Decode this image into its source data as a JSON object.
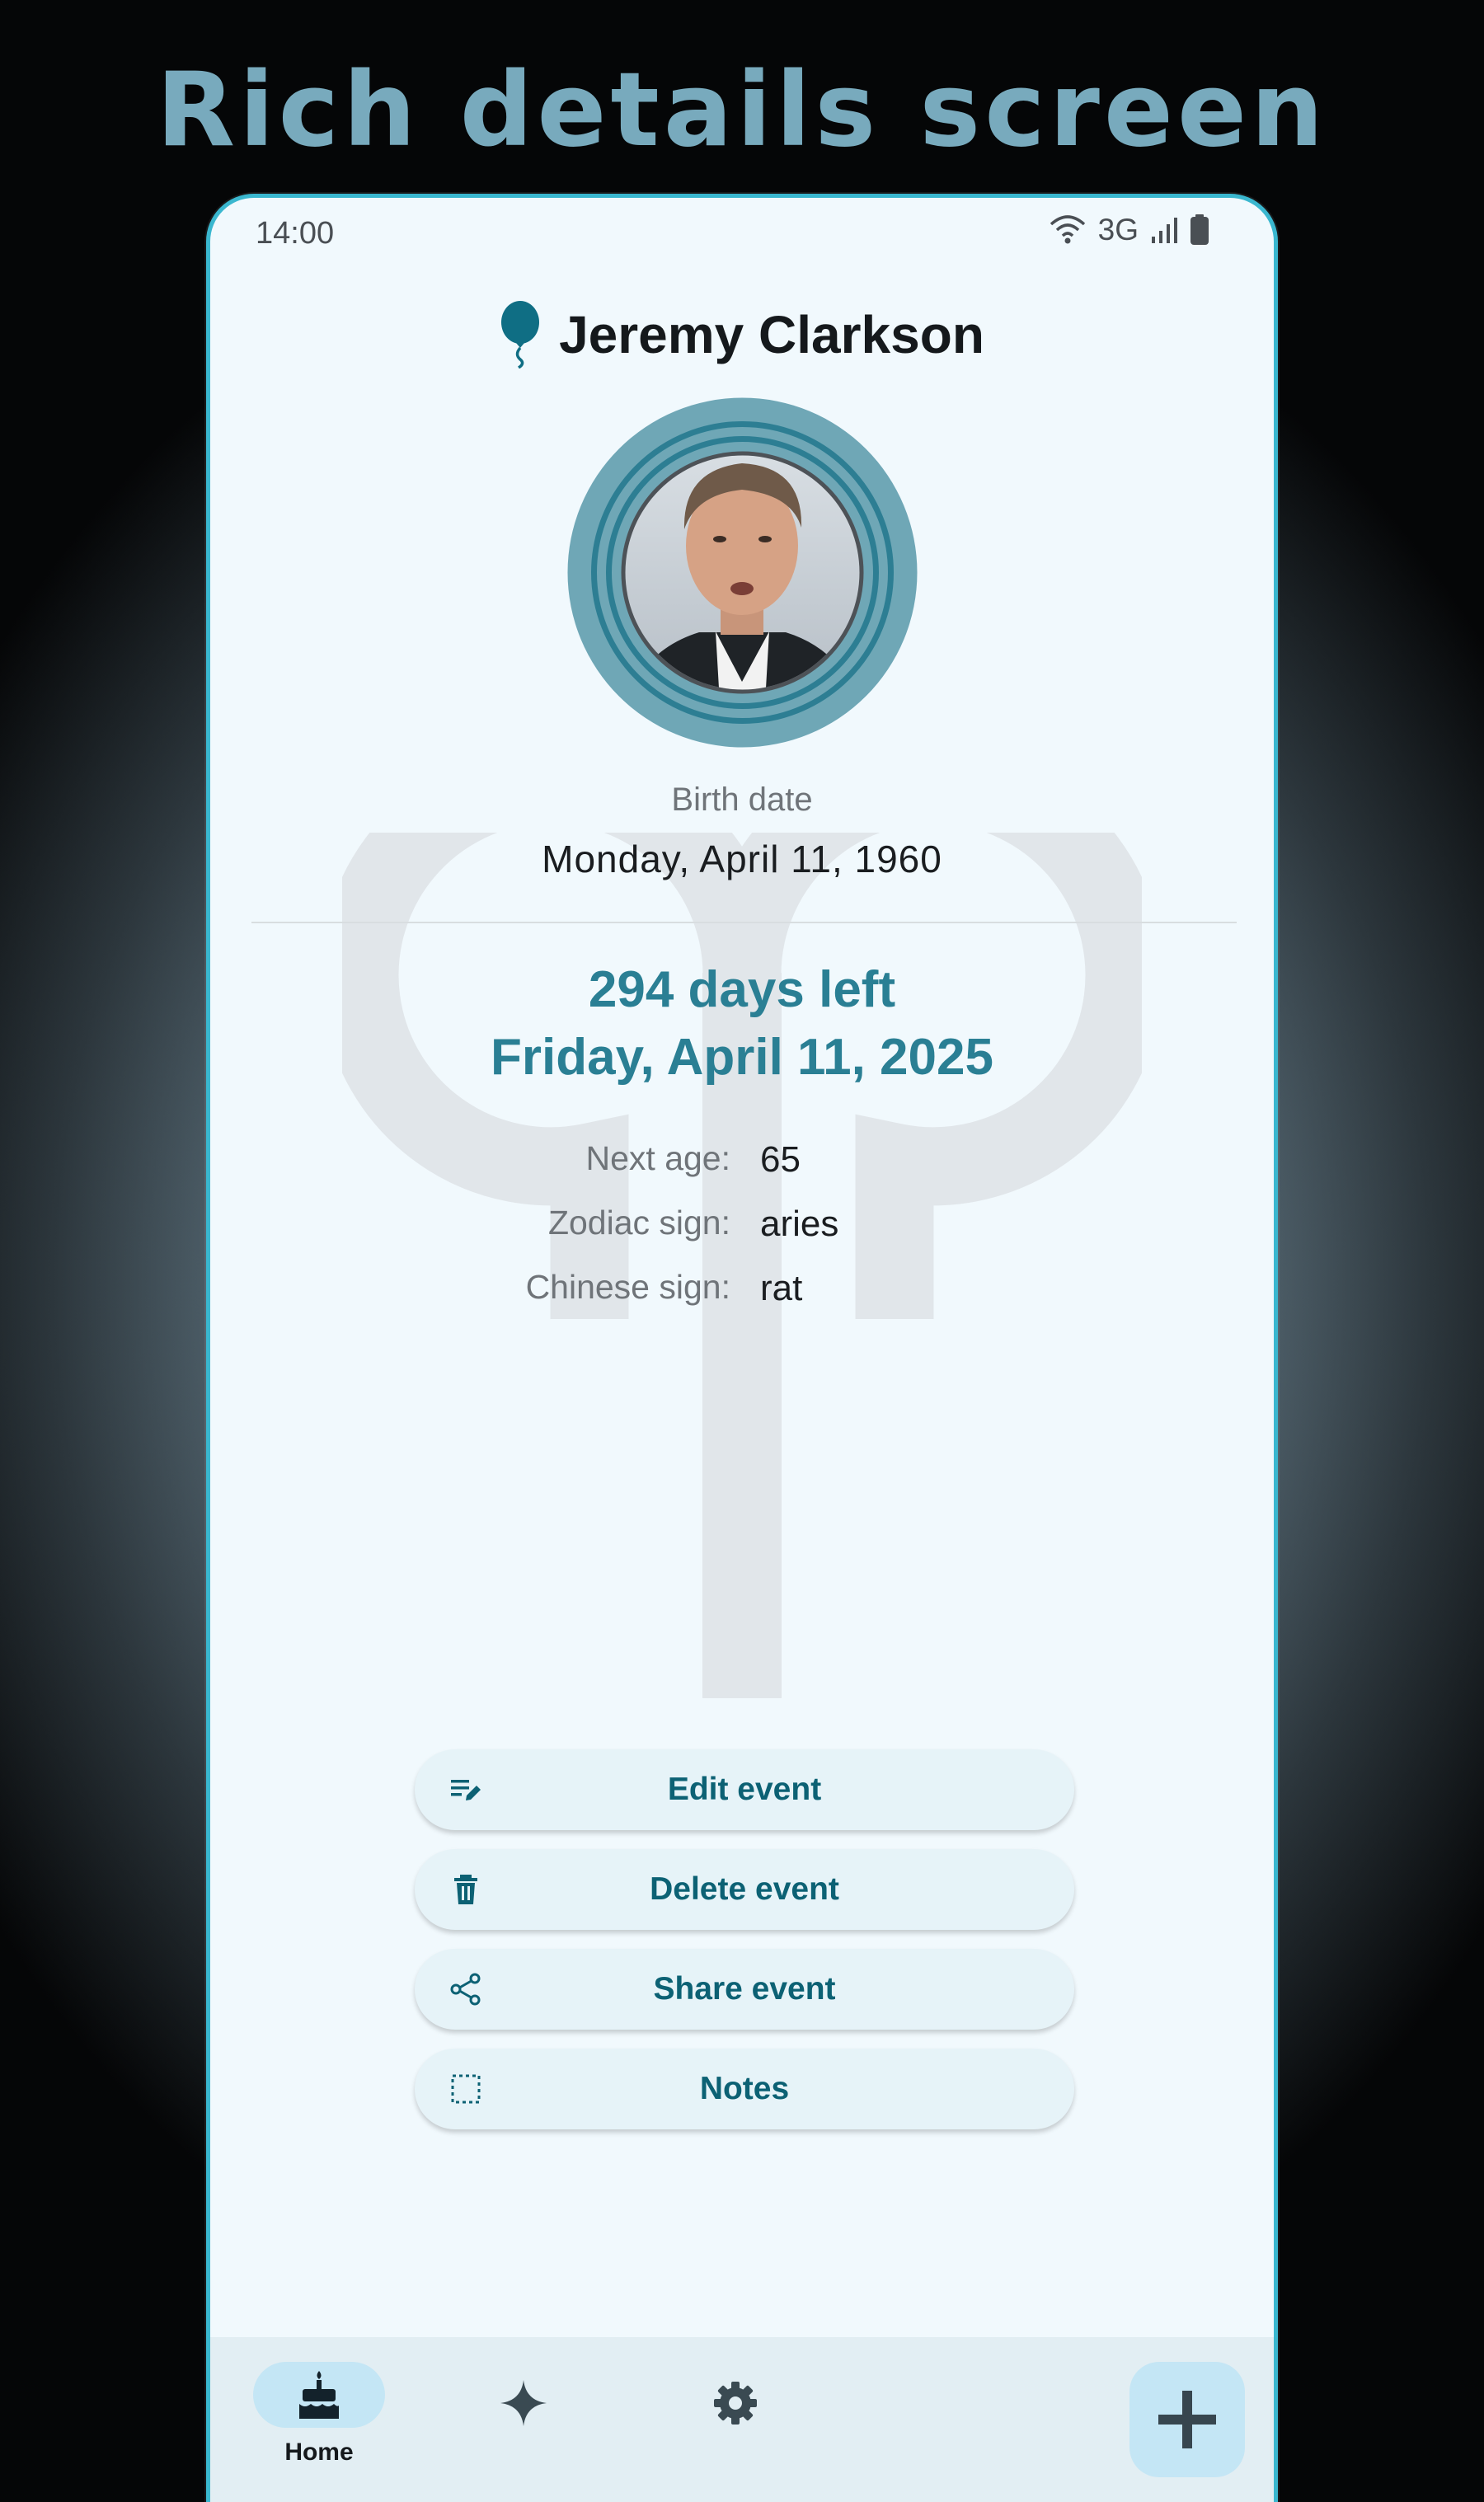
{
  "headline": "Rich details screen",
  "status_bar": {
    "time": "14:00",
    "network": "3G"
  },
  "person": {
    "name": "Jeremy Clarkson"
  },
  "birth": {
    "caption": "Birth date",
    "date": "Monday, April 11, 1960"
  },
  "countdown": {
    "days_left": "294 days left",
    "next_date": "Friday, April 11, 2025"
  },
  "info": [
    {
      "label": "Next age:",
      "value": "65"
    },
    {
      "label": "Zodiac sign:",
      "value": "aries"
    },
    {
      "label": "Chinese sign:",
      "value": "rat"
    }
  ],
  "actions": [
    {
      "label": "Edit event",
      "icon": "edit-note-icon"
    },
    {
      "label": "Delete event",
      "icon": "trash-icon"
    },
    {
      "label": "Share event",
      "icon": "share-icon"
    },
    {
      "label": "Notes",
      "icon": "notes-icon"
    }
  ],
  "nav": {
    "home_label": "Home",
    "items": [
      "cake-icon",
      "sparkle-icon",
      "gear-icon"
    ],
    "fab_icon": "plus-icon"
  },
  "colors": {
    "accent": "#2a7f94",
    "button_text": "#0c6174",
    "avatar_ring": "#6fa7b6",
    "background": "#f1f9fd",
    "headline": "#78aabd"
  }
}
